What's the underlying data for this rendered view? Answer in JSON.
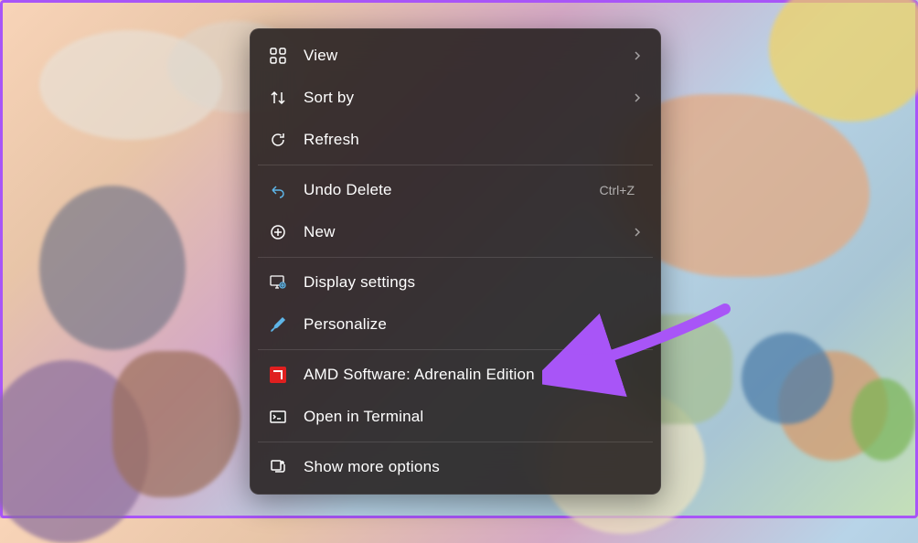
{
  "context_menu": {
    "items": [
      {
        "label": "View",
        "has_submenu": true
      },
      {
        "label": "Sort by",
        "has_submenu": true
      },
      {
        "label": "Refresh"
      },
      {
        "label": "Undo Delete",
        "shortcut": "Ctrl+Z"
      },
      {
        "label": "New",
        "has_submenu": true
      },
      {
        "label": "Display settings"
      },
      {
        "label": "Personalize"
      },
      {
        "label": "AMD Software: Adrenalin Edition"
      },
      {
        "label": "Open in Terminal"
      },
      {
        "label": "Show more options"
      }
    ]
  },
  "annotation": {
    "arrow_color": "#a855f7",
    "target": "amd-software-menu-item"
  }
}
